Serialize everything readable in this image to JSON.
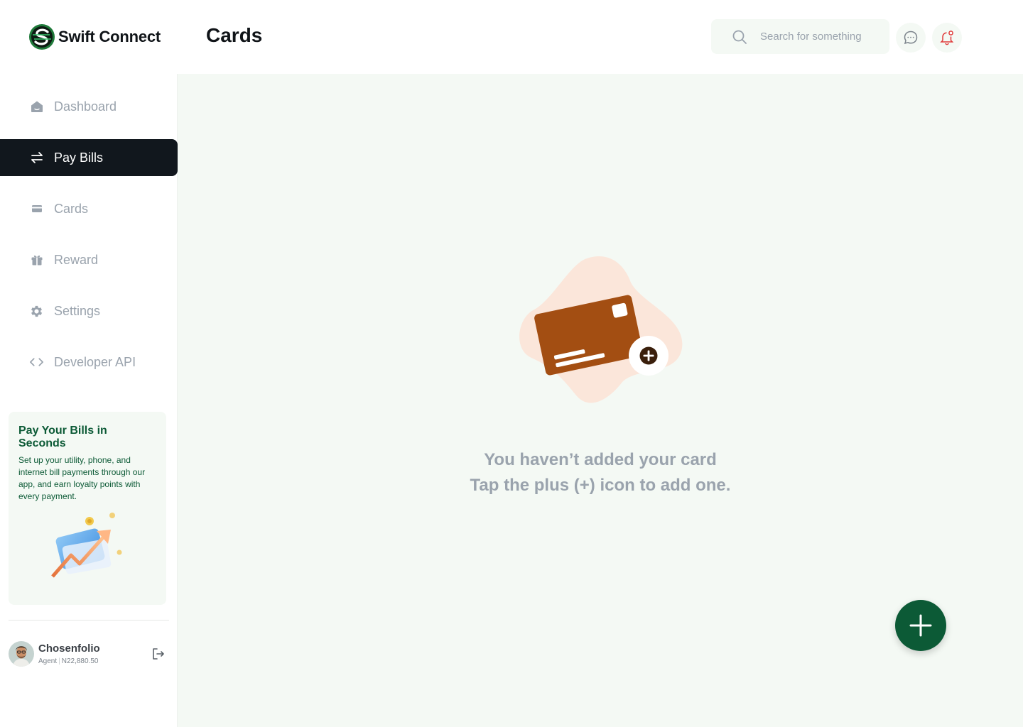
{
  "brand": {
    "name": "Swift Connect",
    "logo_icon": "swift-connect-logo"
  },
  "header": {
    "title": "Cards",
    "search_placeholder": "Search for something",
    "search_icon": "search-icon",
    "messages_icon": "chat-bubble-icon",
    "notifications_icon": "bell-icon"
  },
  "sidebar": {
    "items": [
      {
        "label": "Dashboard",
        "icon": "home-icon",
        "active": false
      },
      {
        "label": "Pay Bills",
        "icon": "transfer-arrows-icon",
        "active": true
      },
      {
        "label": "Cards",
        "icon": "card-icon",
        "active": false
      },
      {
        "label": "Reward",
        "icon": "gift-icon",
        "active": false
      },
      {
        "label": "Settings",
        "icon": "gear-icon",
        "active": false
      },
      {
        "label": "Developer API",
        "icon": "code-icon",
        "active": false
      }
    ],
    "promo": {
      "title": "Pay Your Bills in Seconds",
      "text": "Set up your utility, phone, and internet bill payments through our app, and earn loyalty points with every payment."
    },
    "user": {
      "name": "Chosenfolio",
      "role": "Agent",
      "balance": "N22,880.50"
    }
  },
  "main": {
    "empty_line1": "You haven’t added your card",
    "empty_line2": "Tap the plus (+) icon to add one.",
    "fab_icon": "plus-icon"
  },
  "colors": {
    "brand_green": "#0c5a36",
    "active_nav": "#11171d",
    "main_bg": "#f4f9f4",
    "card_brown": "#a34e12",
    "blob_peach": "#fbe6da",
    "muted_text": "#9aa3ad",
    "alert_red": "#e03b3b"
  }
}
